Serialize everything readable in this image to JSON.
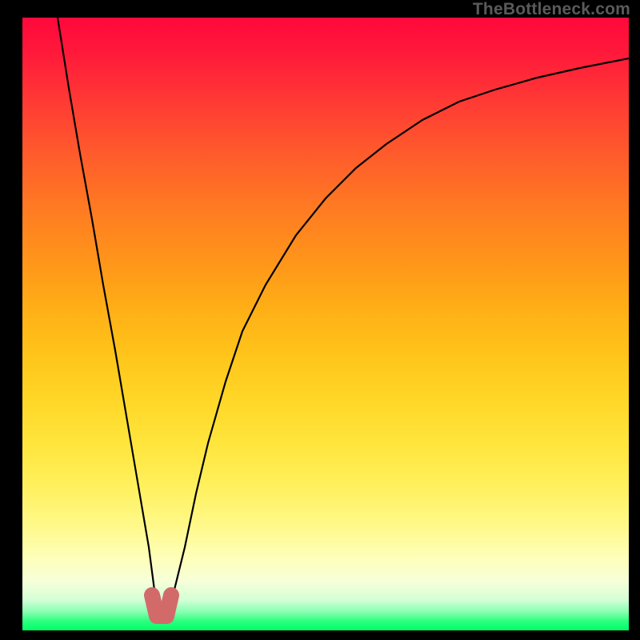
{
  "watermark": "TheBottleneck.com",
  "colors": {
    "frame": "#000000",
    "marker": "#d36a6a",
    "curve": "#000000"
  },
  "chart_data": {
    "type": "line",
    "title": "",
    "xlabel": "",
    "ylabel": "",
    "xlim": [
      0,
      100
    ],
    "ylim": [
      0,
      100
    ],
    "grid": false,
    "legend": false,
    "annotations": [
      "TheBottleneck.com"
    ],
    "series": [
      {
        "name": "bottleneck-curve",
        "x": [
          4,
          6,
          8,
          10,
          12,
          14,
          16,
          18,
          20,
          21,
          22,
          23,
          24,
          26,
          28,
          30,
          33,
          36,
          40,
          45,
          50,
          55,
          60,
          66,
          72,
          78,
          85,
          92,
          100
        ],
        "values": [
          100,
          88,
          77,
          66,
          55,
          44,
          33,
          22,
          11,
          5,
          1,
          1,
          5,
          13,
          22,
          30,
          40,
          48,
          56,
          64,
          70,
          75,
          79,
          83,
          86,
          88,
          90,
          91.5,
          93
        ]
      }
    ],
    "marker": {
      "name": "optimal-range",
      "x_range": [
        21,
        23
      ],
      "value": 0
    },
    "gradient_scale": {
      "orientation": "vertical",
      "top_value": 100,
      "bottom_value": 0,
      "top_color": "#ff083b",
      "bottom_color": "#00ff6a"
    }
  }
}
